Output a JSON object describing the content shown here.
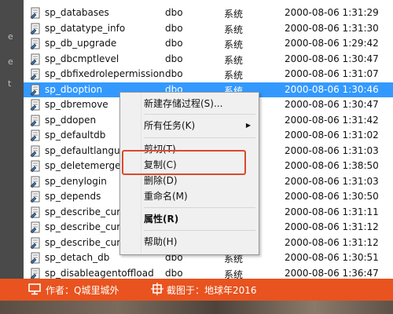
{
  "left_strip_chars": [
    "e",
    "e",
    "t"
  ],
  "rows": [
    {
      "name": "sp_databases",
      "owner": "dbo",
      "type": "系统",
      "date": "2000-08-06 1:31:29"
    },
    {
      "name": "sp_datatype_info",
      "owner": "dbo",
      "type": "系统",
      "date": "2000-08-06 1:31:30"
    },
    {
      "name": "sp_db_upgrade",
      "owner": "dbo",
      "type": "系统",
      "date": "2000-08-06 1:29:42"
    },
    {
      "name": "sp_dbcmptlevel",
      "owner": "dbo",
      "type": "系统",
      "date": "2000-08-06 1:30:47"
    },
    {
      "name": "sp_dbfixedrolepermission",
      "owner": "dbo",
      "type": "系统",
      "date": "2000-08-06 1:31:07"
    },
    {
      "name": "sp_dboption",
      "owner": "dbo",
      "type": "系统",
      "date": "2000-08-06 1:30:46",
      "selected": true
    },
    {
      "name": "sp_dbremove",
      "owner": "",
      "type": "",
      "date": "2000-08-06 1:30:47"
    },
    {
      "name": "sp_ddopen",
      "owner": "",
      "type": "",
      "date": "2000-08-06 1:31:42"
    },
    {
      "name": "sp_defaultdb",
      "owner": "",
      "type": "",
      "date": "2000-08-06 1:31:02"
    },
    {
      "name": "sp_defaultlanguag",
      "owner": "",
      "type": "",
      "date": "2000-08-06 1:31:03"
    },
    {
      "name": "sp_deletemergeco",
      "owner": "",
      "type": "",
      "date": "2000-08-06 1:38:50"
    },
    {
      "name": "sp_denylogin",
      "owner": "",
      "type": "",
      "date": "2000-08-06 1:31:03"
    },
    {
      "name": "sp_depends",
      "owner": "",
      "type": "",
      "date": "2000-08-06 1:30:50"
    },
    {
      "name": "sp_describe_curso",
      "owner": "",
      "type": "",
      "date": "2000-08-06 1:31:11"
    },
    {
      "name": "sp_describe_curso",
      "owner": "",
      "type": "",
      "date": "2000-08-06 1:31:12"
    },
    {
      "name": "sp_describe_curso",
      "owner": "",
      "type": "",
      "date": "2000-08-06 1:31:12"
    },
    {
      "name": "sp_detach_db",
      "owner": "dbo",
      "type": "系统",
      "date": "2000-08-06 1:30:51"
    },
    {
      "name": "sp_disableagentoffload",
      "owner": "dbo",
      "type": "系统",
      "date": "2000-08-06 1:36:47"
    }
  ],
  "context_menu": {
    "new_proc": "新建存储过程(S)...",
    "all_tasks": "所有任务(K)",
    "all_tasks_arrow": "▶",
    "cut": "剪切(T)",
    "copy": "复制(C)",
    "delete": "删除(D)",
    "rename": "重命名(M)",
    "properties": "属性(R)",
    "help": "帮助(H)"
  },
  "banner": {
    "author": "作者：Q城里城外",
    "source": "截图于：地球年2016"
  },
  "colors": {
    "selection": "#3399ff",
    "highlight_box": "#d84a2e",
    "banner": "#e8531f"
  }
}
